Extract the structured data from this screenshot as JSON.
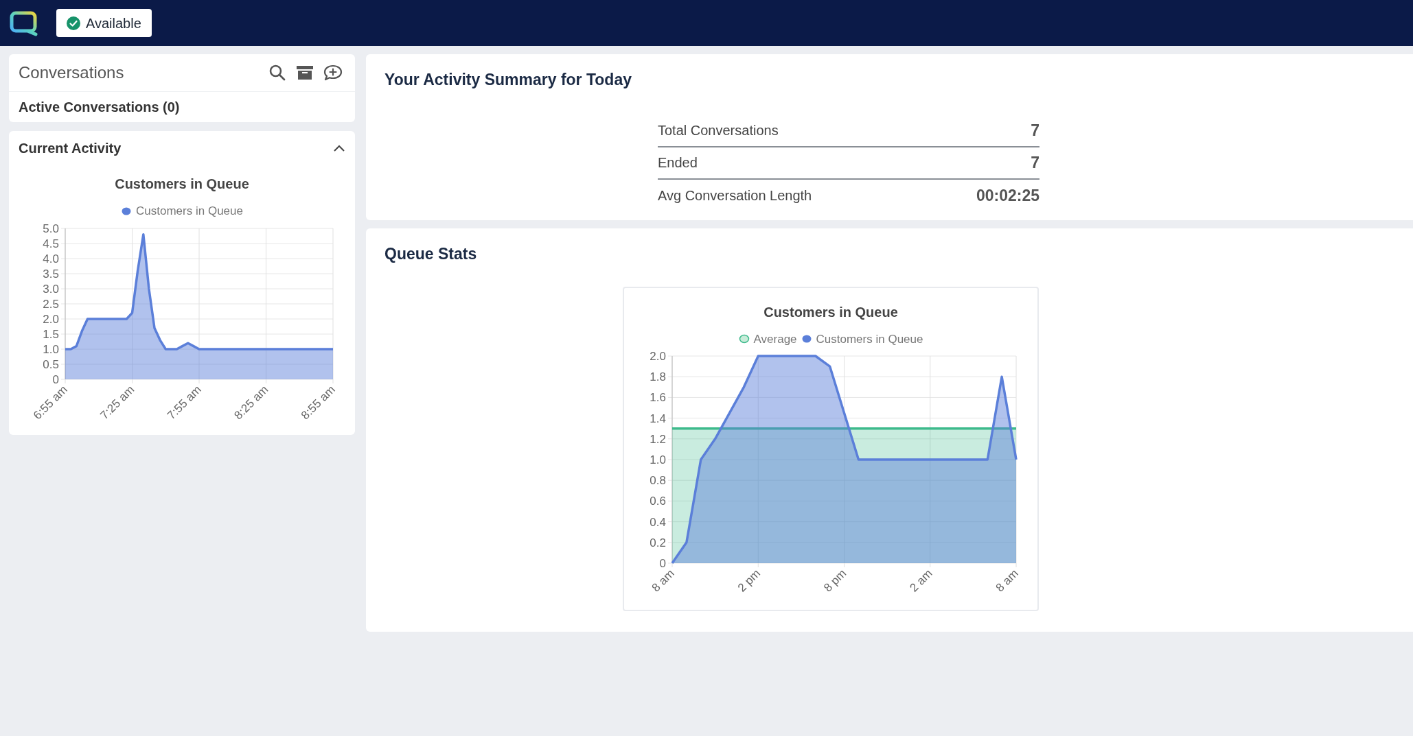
{
  "top_bar": {
    "status": {
      "label": "Available"
    }
  },
  "conversations": {
    "title": "Conversations",
    "active_label": "Active Conversations (0)"
  },
  "current_activity": {
    "title": "Current Activity",
    "expanded": true,
    "chart_data": {
      "type": "area",
      "title": "Customers in Queue",
      "categories": [
        "6:55 am",
        null,
        null,
        null,
        null,
        null,
        null,
        null,
        null,
        null,
        null,
        null,
        "7:25 am",
        null,
        null,
        null,
        null,
        null,
        null,
        null,
        null,
        null,
        null,
        null,
        "7:55 am",
        null,
        null,
        null,
        null,
        null,
        null,
        null,
        null,
        null,
        null,
        null,
        "8:25 am",
        null,
        null,
        null,
        null,
        null,
        null,
        null,
        null,
        null,
        null,
        null,
        "8:55 am"
      ],
      "series": [
        {
          "name": "Customers in Queue",
          "color": "#5b7fd9",
          "values": [
            1.0,
            1.0,
            1.1,
            1.6,
            2.0,
            2.0,
            2.0,
            2.0,
            2.0,
            2.0,
            2.0,
            2.0,
            2.2,
            3.6,
            4.8,
            3.0,
            1.7,
            1.3,
            1.0,
            1.0,
            1.0,
            1.1,
            1.2,
            1.1,
            1.0,
            1.0,
            1.0,
            1.0,
            1.0,
            1.0,
            1.0,
            1.0,
            1.0,
            1.0,
            1.0,
            1.0,
            1.0,
            1.0,
            1.0,
            1.0,
            1.0,
            1.0,
            1.0,
            1.0,
            1.0,
            1.0,
            1.0,
            1.0,
            1.0
          ]
        }
      ],
      "ylim": [
        0,
        5
      ],
      "grid": true,
      "legend": "top",
      "yticks": [
        {
          "value": 0,
          "label": "0"
        },
        {
          "value": 0.5,
          "label": "0.5"
        },
        {
          "value": 1,
          "label": "1.0"
        },
        {
          "value": 1.5,
          "label": "1.5"
        },
        {
          "value": 2,
          "label": "2.0"
        },
        {
          "value": 2.5,
          "label": "2.5"
        },
        {
          "value": 3,
          "label": "3.0"
        },
        {
          "value": 3.5,
          "label": "3.5"
        },
        {
          "value": 4,
          "label": "4.0"
        },
        {
          "value": 4.5,
          "label": "4.5"
        },
        {
          "value": 5,
          "label": "5.0"
        }
      ]
    }
  },
  "activity_summary": {
    "title": "Your Activity Summary for Today",
    "rows": [
      {
        "label": "Total Conversations",
        "value": "7"
      },
      {
        "label": "Ended",
        "value": "7"
      },
      {
        "label": "Avg Conversation Length",
        "value": "00:02:25"
      }
    ]
  },
  "queue_stats": {
    "title": "Queue Stats",
    "chart_data": {
      "type": "area",
      "title": "Customers in Queue",
      "categories": [
        "8 am",
        null,
        null,
        null,
        null,
        null,
        "2 pm",
        null,
        null,
        null,
        null,
        null,
        "8 pm",
        null,
        null,
        null,
        null,
        null,
        "2 am",
        null,
        null,
        null,
        null,
        null,
        "8 am"
      ],
      "series": [
        {
          "name": "Average",
          "color": "#3dba8c",
          "values": [
            1.3,
            1.3,
            1.3,
            1.3,
            1.3,
            1.3,
            1.3,
            1.3,
            1.3,
            1.3,
            1.3,
            1.3,
            1.3,
            1.3,
            1.3,
            1.3,
            1.3,
            1.3,
            1.3,
            1.3,
            1.3,
            1.3,
            1.3,
            1.3,
            1.3
          ]
        },
        {
          "name": "Customers in Queue",
          "color": "#5b7fd9",
          "values": [
            0,
            0.2,
            1.0,
            1.2,
            1.45,
            1.7,
            2.0,
            2.0,
            2.0,
            2.0,
            2.0,
            1.9,
            1.45,
            1.0,
            1.0,
            1.0,
            1.0,
            1.0,
            1.0,
            1.0,
            1.0,
            1.0,
            1.0,
            1.8,
            1.0
          ]
        }
      ],
      "ylim": [
        0,
        2
      ],
      "grid": true,
      "legend": "top",
      "yticks": [
        {
          "value": 0,
          "label": "0"
        },
        {
          "value": 0.2,
          "label": "0.2"
        },
        {
          "value": 0.4,
          "label": "0.4"
        },
        {
          "value": 0.6,
          "label": "0.6"
        },
        {
          "value": 0.8,
          "label": "0.8"
        },
        {
          "value": 1,
          "label": "1.0"
        },
        {
          "value": 1.2,
          "label": "1.2"
        },
        {
          "value": 1.4,
          "label": "1.4"
        },
        {
          "value": 1.6,
          "label": "1.6"
        },
        {
          "value": 1.8,
          "label": "1.8"
        },
        {
          "value": 2,
          "label": "2.0"
        }
      ]
    }
  }
}
